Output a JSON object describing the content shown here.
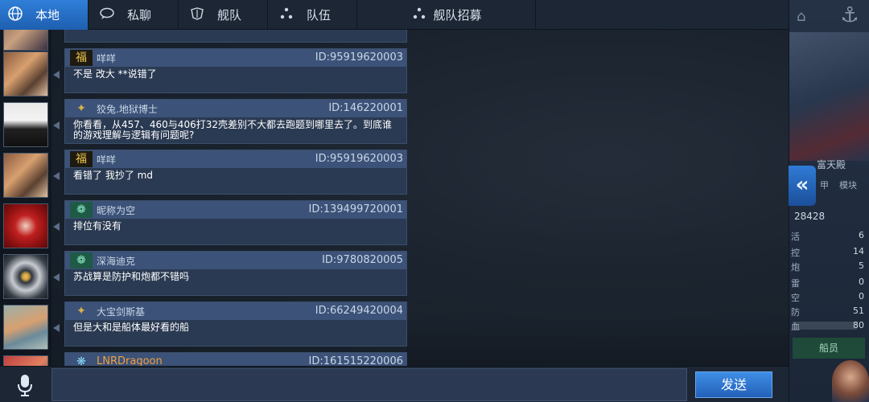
{
  "tabs": [
    {
      "label": "本地",
      "icon": "globe-icon",
      "active": true
    },
    {
      "label": "私聊",
      "icon": "chat-bubble-icon",
      "active": false
    },
    {
      "label": "舰队",
      "icon": "fleet-icon",
      "active": false
    },
    {
      "label": "队伍",
      "icon": "team-icon",
      "active": false
    },
    {
      "label": "舰队招募",
      "icon": "recruit-icon",
      "active": false
    }
  ],
  "messages": [
    {
      "name": "咩咩",
      "uid": "ID:95919620003",
      "text": "不是 改大 **说错了",
      "badge": "福",
      "badge_type": "fu"
    },
    {
      "name": "狡兔.地狱博士",
      "uid": "ID:146220001",
      "text": "你看看，从457、460与406打32壳差别不大都去跑题到哪里去了。到底谁的游戏理解与逻辑有问题呢?",
      "badge": "✦",
      "badge_type": "rank-gold"
    },
    {
      "name": "咩咩",
      "uid": "ID:95919620003",
      "text": "看错了 我抄了 md",
      "badge": "福",
      "badge_type": "fu"
    },
    {
      "name": "昵称为空",
      "uid": "ID:139499720001",
      "text": "排位有没有",
      "badge": "❁",
      "badge_type": "rank-green"
    },
    {
      "name": "深海迪克",
      "uid": "ID:9780820005",
      "text": "苏战算是防护和炮都不错吗",
      "badge": "❁",
      "badge_type": "rank-green"
    },
    {
      "name": "大宝剑斯基",
      "uid": "ID:66249420004",
      "text": "但是大和是船体最好看的船",
      "badge": "✦",
      "badge_type": "rank-gold"
    },
    {
      "name": "LNRDragoon",
      "uid": "ID:161515220006",
      "text": "",
      "badge": "❋",
      "badge_type": "rank-cyan"
    }
  ],
  "input": {
    "send_label": "发送"
  },
  "side": {
    "name": "富天殿",
    "power": "28428",
    "tab_a": "甲",
    "tab_b": "模块",
    "stats": [
      "6",
      "14",
      "5",
      "0",
      "0",
      "51",
      "80"
    ],
    "stat_labels": [
      "活",
      "控",
      "炮",
      "雷",
      "空",
      "防",
      "血"
    ],
    "crew_label": "船员"
  },
  "colors": {
    "accent": "#2f7fd9",
    "panel": "#2a3a52",
    "header": "#3c5278"
  }
}
